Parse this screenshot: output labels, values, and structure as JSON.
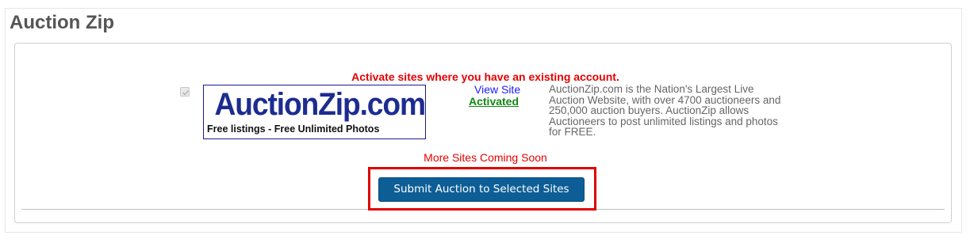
{
  "section": {
    "title": "Auction Zip"
  },
  "notice": {
    "activate_text": "Activate sites where you have an existing account."
  },
  "site": {
    "checkbox_checked": true,
    "checkbox_disabled": true,
    "logo_wordmark": "AuctionZip.com",
    "logo_tagline": "Free listings - Free Unlimited Photos",
    "view_site_label": "View Site",
    "status_label": "Activated",
    "description": "AuctionZip.com is the Nation's Largest Live Auction Website, with over 4700 auctioneers and 250,000 auction buyers. AuctionZip allows Auctioneers to post unlimited listings and photos for FREE."
  },
  "footer": {
    "coming_soon_text": "More Sites Coming Soon",
    "submit_label": "Submit Auction to Selected Sites"
  },
  "colors": {
    "title": "#555555",
    "alert_red": "#e60000",
    "link_blue": "#1a1aff",
    "activated_green": "#118811",
    "logo_navy": "#1c2c8f",
    "button_blue": "#0d5e96",
    "highlight_red": "#e00000"
  }
}
